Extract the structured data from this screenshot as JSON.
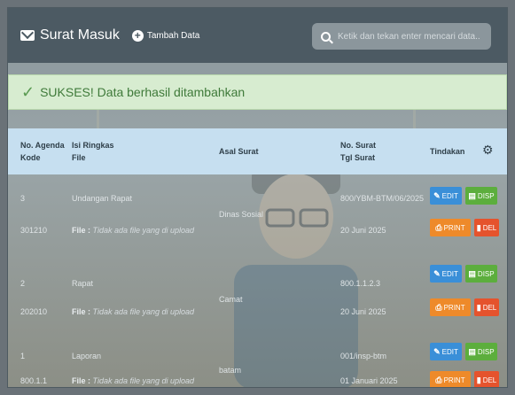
{
  "header": {
    "title": "Surat Masuk",
    "add_label": "Tambah Data",
    "search_placeholder": "Ketik dan tekan enter mencari data..."
  },
  "alert": {
    "text": "SUKSES! Data berhasil ditambahkan"
  },
  "table": {
    "col1": [
      "No. Agenda",
      "Kode"
    ],
    "col2": [
      "Isi Ringkas",
      "File"
    ],
    "col3": "Asal Surat",
    "col4": [
      "No. Surat",
      "Tgl Surat"
    ],
    "col5": "Tindakan",
    "rows": [
      {
        "no": "3",
        "kode": "301210",
        "isi": "Undangan Rapat",
        "file_label": "File :",
        "file_value": "Tidak ada file yang di upload",
        "asal": "Dinas Sosial",
        "no_surat": "800/YBM-BTM/06/2025",
        "tgl": "20 Juni 2025"
      },
      {
        "no": "2",
        "kode": "202010",
        "isi": "Rapat",
        "file_label": "File :",
        "file_value": "Tidak ada file yang di upload",
        "asal": "Camat",
        "no_surat": "800.1.1.2.3",
        "tgl": "20 Juni 2025"
      },
      {
        "no": "1",
        "kode": "800.1.1",
        "isi": "Laporan",
        "file_label": "File :",
        "file_value": "Tidak ada file yang di upload",
        "asal": "batam",
        "no_surat": "001/insp-btm",
        "tgl": "01 Januari 2025"
      }
    ]
  },
  "actions": {
    "edit": "EDIT",
    "disp": "DISP",
    "print": "PRINT",
    "del": "DEL"
  },
  "colors": {
    "header": "#4c5a63",
    "alert_bg": "#d7ecd0",
    "thead": "#c6dff0",
    "edit": "#3a8fd8",
    "disp": "#5cae3d",
    "print": "#ee8a2a",
    "del": "#e5532d"
  },
  "icons": {
    "brand": "envelope-icon",
    "add": "plus-circle-icon",
    "search": "search-icon",
    "alert": "check-icon",
    "settings": "gear-icon"
  }
}
